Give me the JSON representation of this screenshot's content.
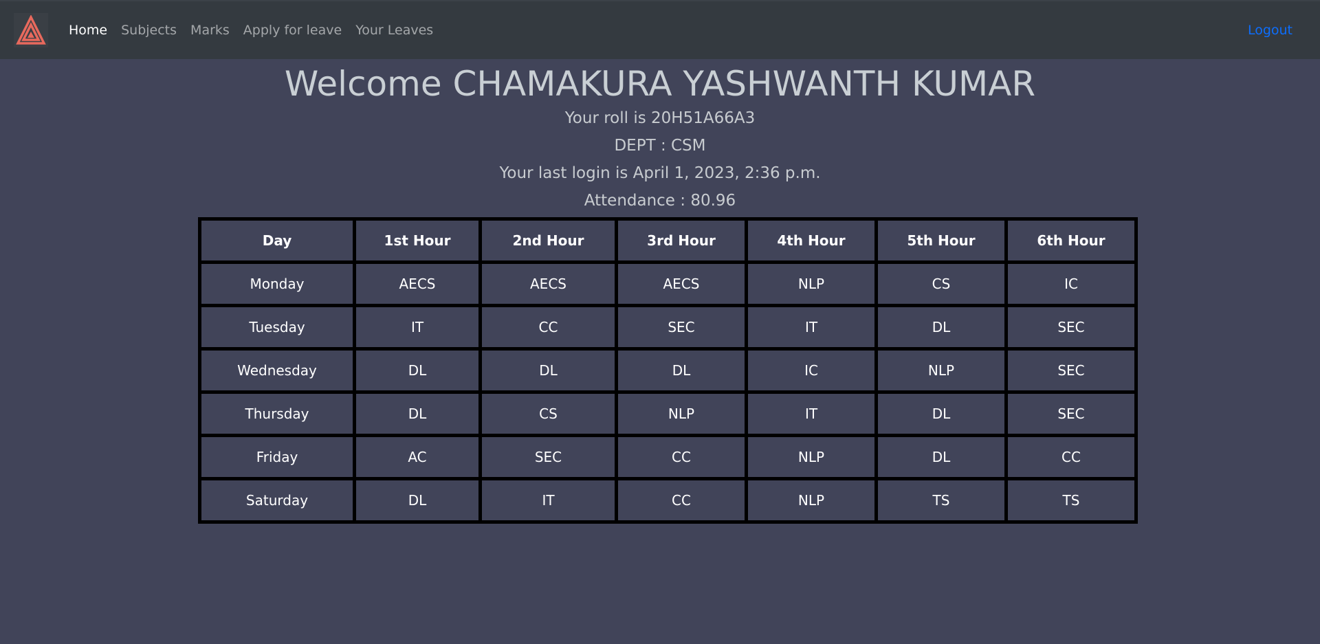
{
  "nav": {
    "logo": "triangle-logo-icon",
    "links": [
      {
        "label": "Home",
        "active": true
      },
      {
        "label": "Subjects",
        "active": false
      },
      {
        "label": "Marks",
        "active": false
      },
      {
        "label": "Apply for leave",
        "active": false
      },
      {
        "label": "Your Leaves",
        "active": false
      }
    ],
    "logout_label": "Logout",
    "colors": {
      "navbar": "#343a40",
      "logout": "#0d6efd",
      "logo": "#e8695d"
    }
  },
  "main": {
    "welcome": "Welcome CHAMAKURA YASHWANTH KUMAR",
    "roll": "Your roll is 20H51A66A3",
    "dept": "DEPT : CSM",
    "last_login": "Your last login is April 1, 2023, 2:36 p.m.",
    "attendance": "Attendance : 80.96"
  },
  "timetable": {
    "headers": [
      "Day",
      "1st Hour",
      "2nd Hour",
      "3rd Hour",
      "4th Hour",
      "5th Hour",
      "6th Hour"
    ],
    "rows": [
      [
        "Monday",
        "AECS",
        "AECS",
        "AECS",
        "NLP",
        "CS",
        "IC"
      ],
      [
        "Tuesday",
        "IT",
        "CC",
        "SEC",
        "IT",
        "DL",
        "SEC"
      ],
      [
        "Wednesday",
        "DL",
        "DL",
        "DL",
        "IC",
        "NLP",
        "SEC"
      ],
      [
        "Thursday",
        "DL",
        "CS",
        "NLP",
        "IT",
        "DL",
        "SEC"
      ],
      [
        "Friday",
        "AC",
        "SEC",
        "CC",
        "NLP",
        "DL",
        "CC"
      ],
      [
        "Saturday",
        "DL",
        "IT",
        "CC",
        "NLP",
        "TS",
        "TS"
      ]
    ]
  }
}
